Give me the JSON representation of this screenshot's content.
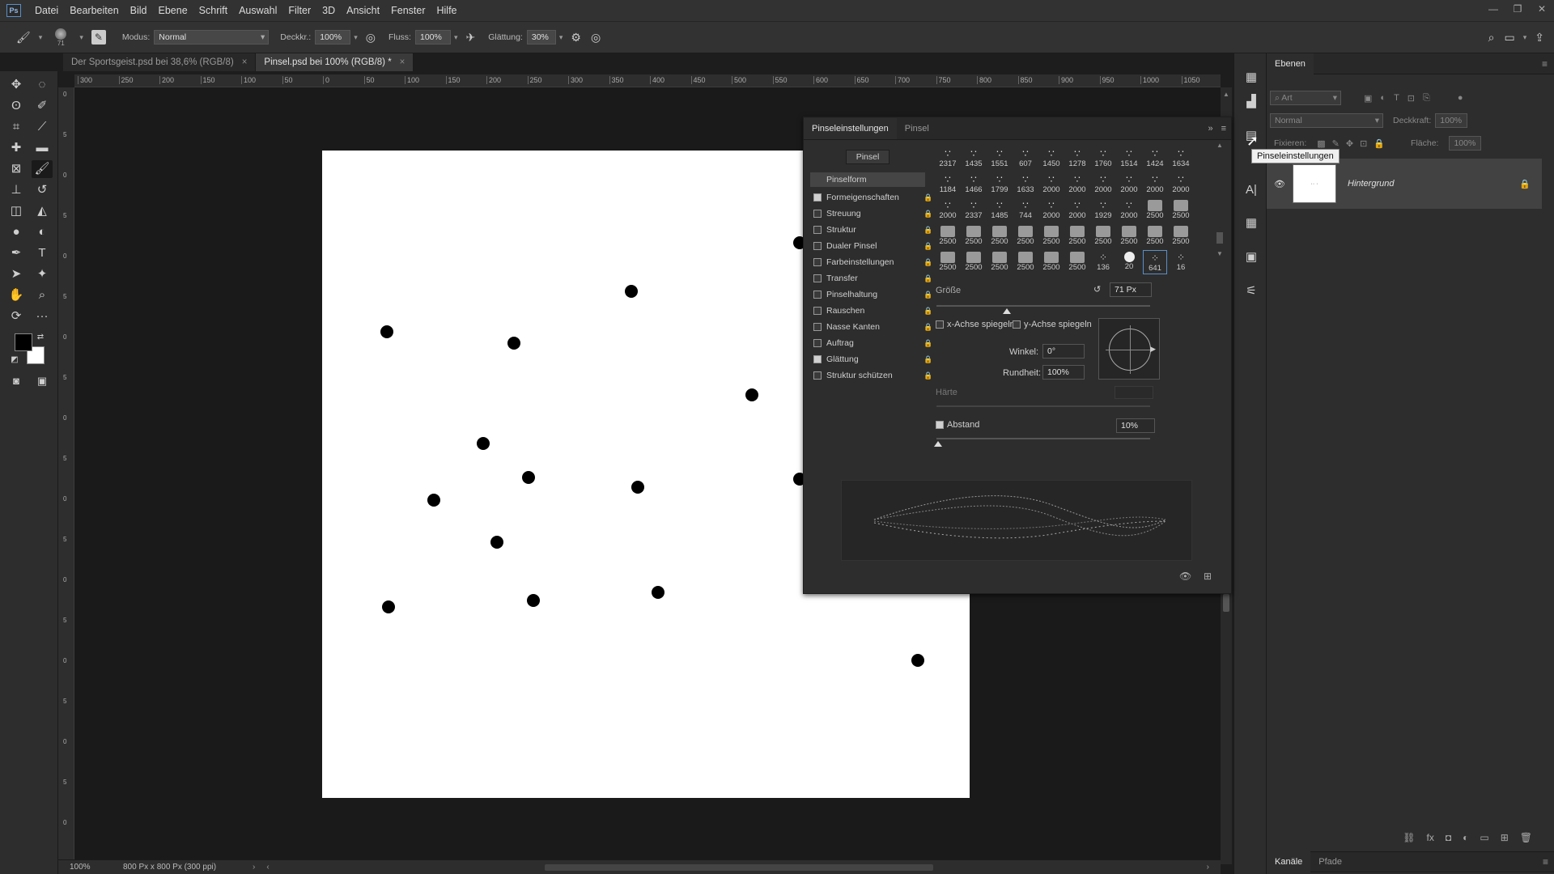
{
  "app": {
    "logo": "Ps"
  },
  "menu": [
    "Datei",
    "Bearbeiten",
    "Bild",
    "Ebene",
    "Schrift",
    "Auswahl",
    "Filter",
    "3D",
    "Ansicht",
    "Fenster",
    "Hilfe"
  ],
  "options": {
    "brush_size": "71",
    "modus_label": "Modus:",
    "modus_value": "Normal",
    "deckkraft_label": "Deckkr.:",
    "deckkraft_value": "100%",
    "fluss_label": "Fluss:",
    "fluss_value": "100%",
    "glaettung_label": "Glättung:",
    "glaettung_value": "30%"
  },
  "tabs": [
    {
      "label": "Der Sportsgeist.psd bei 38,6% (RGB/8)",
      "close": "×"
    },
    {
      "label": "Pinsel.psd bei 100% (RGB/8) *",
      "close": "×"
    }
  ],
  "ruler_top": [
    "300",
    "250",
    "200",
    "150",
    "100",
    "50",
    "0",
    "50",
    "100",
    "150",
    "200",
    "250",
    "300",
    "350",
    "400",
    "450",
    "500",
    "550",
    "600",
    "650",
    "700",
    "750",
    "800",
    "850",
    "900",
    "950",
    "1000",
    "1050",
    "1100"
  ],
  "ruler_left": [
    "0",
    "5",
    "0",
    "5",
    "0",
    "5",
    "0",
    "5",
    "0",
    "5",
    "0",
    "5",
    "0",
    "5",
    "0",
    "5",
    "0",
    "5",
    "0"
  ],
  "status": {
    "zoom": "100%",
    "doc_size": "800 Px x 800 Px (300 ppi)"
  },
  "brush_panel": {
    "tab_active": "Pinseleinstellungen",
    "tab_other": "Pinsel",
    "pinsel_button": "Pinsel",
    "pinselform": "Pinselform",
    "options": [
      {
        "label": "Formeigenschaften",
        "checked": true
      },
      {
        "label": "Streuung",
        "checked": false
      },
      {
        "label": "Struktur",
        "checked": false
      },
      {
        "label": "Dualer Pinsel",
        "checked": false
      },
      {
        "label": "Farbeinstellungen",
        "checked": false
      },
      {
        "label": "Transfer",
        "checked": false
      },
      {
        "label": "Pinselhaltung",
        "checked": false
      },
      {
        "label": "Rauschen",
        "checked": false
      },
      {
        "label": "Nasse Kanten",
        "checked": false
      },
      {
        "label": "Auftrag",
        "checked": false
      },
      {
        "label": "Glättung",
        "checked": true
      },
      {
        "label": "Struktur schützen",
        "checked": false
      }
    ],
    "presets": [
      [
        "2317",
        "1435",
        "1551",
        "607",
        "1450",
        "1278",
        "1760",
        "1514",
        "1424",
        "1634"
      ],
      [
        "1184",
        "1466",
        "1799",
        "1633",
        "2000",
        "2000",
        "2000",
        "2000",
        "2000",
        "2000"
      ],
      [
        "2000",
        "2337",
        "1485",
        "744",
        "2000",
        "2000",
        "1929",
        "2000",
        "2500",
        "2500"
      ],
      [
        "2500",
        "2500",
        "2500",
        "2500",
        "2500",
        "2500",
        "2500",
        "2500",
        "2500",
        "2500"
      ],
      [
        "2500",
        "2500",
        "2500",
        "2500",
        "2500",
        "2500",
        "136",
        "20",
        "641",
        "16"
      ]
    ],
    "groesse_label": "Größe",
    "groesse_value": "71 Px",
    "flip_x": "x-Achse spiegeln",
    "flip_y": "y-Achse spiegeln",
    "winkel_label": "Winkel:",
    "winkel_value": "0°",
    "rundheit_label": "Rundheit:",
    "rundheit_value": "100%",
    "haerte_label": "Härte",
    "abstand_label": "Abstand",
    "abstand_value": "10%"
  },
  "tooltip": "Pinseleinstellungen",
  "layers_panel": {
    "tab": "Ebenen",
    "filter_placeholder": "Art",
    "blend": "Normal",
    "deckkraft_label": "Deckkraft:",
    "deckkraft_value": "100%",
    "fixieren_label": "Fixieren:",
    "flaeche_label": "Fläche:",
    "flaeche_value": "100%",
    "layer_name": "Hintergrund",
    "bottom_tabs": [
      "Kanäle",
      "Pfade"
    ]
  },
  "colors": {
    "foreground": "#000000",
    "background": "#ffffff",
    "accent": "#5a8fc8"
  }
}
